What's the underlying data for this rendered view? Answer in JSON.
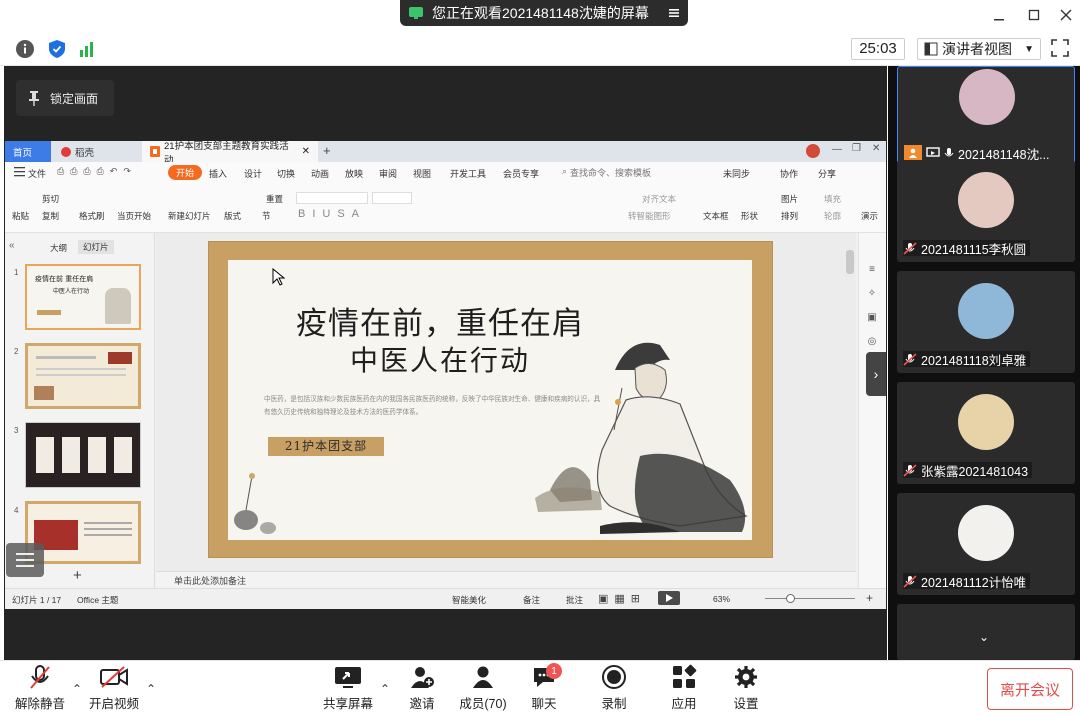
{
  "share_banner": {
    "text": "您正在观看2021481148沈婕的屏幕"
  },
  "meeting": {
    "timer": "25:03",
    "view_mode": "演讲者视图",
    "lock_screen": "锁定画面"
  },
  "wps": {
    "tabs": {
      "home": "首页",
      "wps": "稻壳",
      "doc": "21护本团支部主题教育实践活动"
    },
    "menu": [
      "文件",
      "开始",
      "插入",
      "设计",
      "切换",
      "动画",
      "放映",
      "审阅",
      "视图",
      "开发工具",
      "会员专享"
    ],
    "search_placeholder": "查找命令、搜索模板",
    "sync": "未同步",
    "collab": "协作",
    "share": "分享",
    "ribbon": {
      "paste": "粘贴",
      "cut": "剪切",
      "copy": "复制",
      "format_painter": "格式刷",
      "start_from_current": "当页开始",
      "new_slide": "新建幻灯片",
      "layout": "版式",
      "section": "节",
      "reset": "重置",
      "align_text": "对齐文本",
      "convert_smartart": "转智能图形",
      "textbox": "文本框",
      "shape": "形状",
      "picture": "图片",
      "arrange": "排列",
      "fill": "填充",
      "outline": "轮廓",
      "slideshow": "演示"
    },
    "thumb_tabs": {
      "outline": "大纲",
      "slides": "幻灯片"
    },
    "notes": "单击此处添加备注",
    "status": {
      "slide_count": "幻灯片 1 / 17",
      "theme": "Office 主题",
      "beautify": "智能美化",
      "notes_btn": "备注",
      "comment": "批注",
      "zoom": "63%"
    }
  },
  "slide": {
    "title_line1": "疫情在前，重任在肩",
    "title_line2": "中医人在行动",
    "body": "中医药，是包括汉族和少数民族医药在内的我国各民族医药的统称，反映了中华民族对生命、健康和疾病的认识，具有悠久历史传统和独特理论及技术方法的医药学体系。",
    "tag": "21护本团支部",
    "thumb1_title": "疫情在前  重任在肩",
    "thumb1_sub": "中医人在行动"
  },
  "participants": [
    {
      "name": "2021481148沈...",
      "color": "#d8b7c4"
    },
    {
      "name": "2021481115李秋圆",
      "color": "#e3c9c0"
    },
    {
      "name": "2021481118刘卓雅",
      "color": "#8fb8d8"
    },
    {
      "name": "张紫露2021481043",
      "color": "#e8d3a8"
    },
    {
      "name": "2021481112计怡唯",
      "color": "#f3f1ee"
    }
  ],
  "bottom": {
    "unmute": "解除静音",
    "start_video": "开启视频",
    "share_screen": "共享屏幕",
    "invite": "邀请",
    "members": "成员(70)",
    "chat": "聊天",
    "chat_badge": "1",
    "record": "录制",
    "apps": "应用",
    "settings": "设置",
    "leave": "离开会议"
  },
  "colors": {
    "accent": "#1f6fe0",
    "leave": "#e14d4d",
    "slide_gold": "#c8a064",
    "wps_orange": "#f46b1f"
  }
}
